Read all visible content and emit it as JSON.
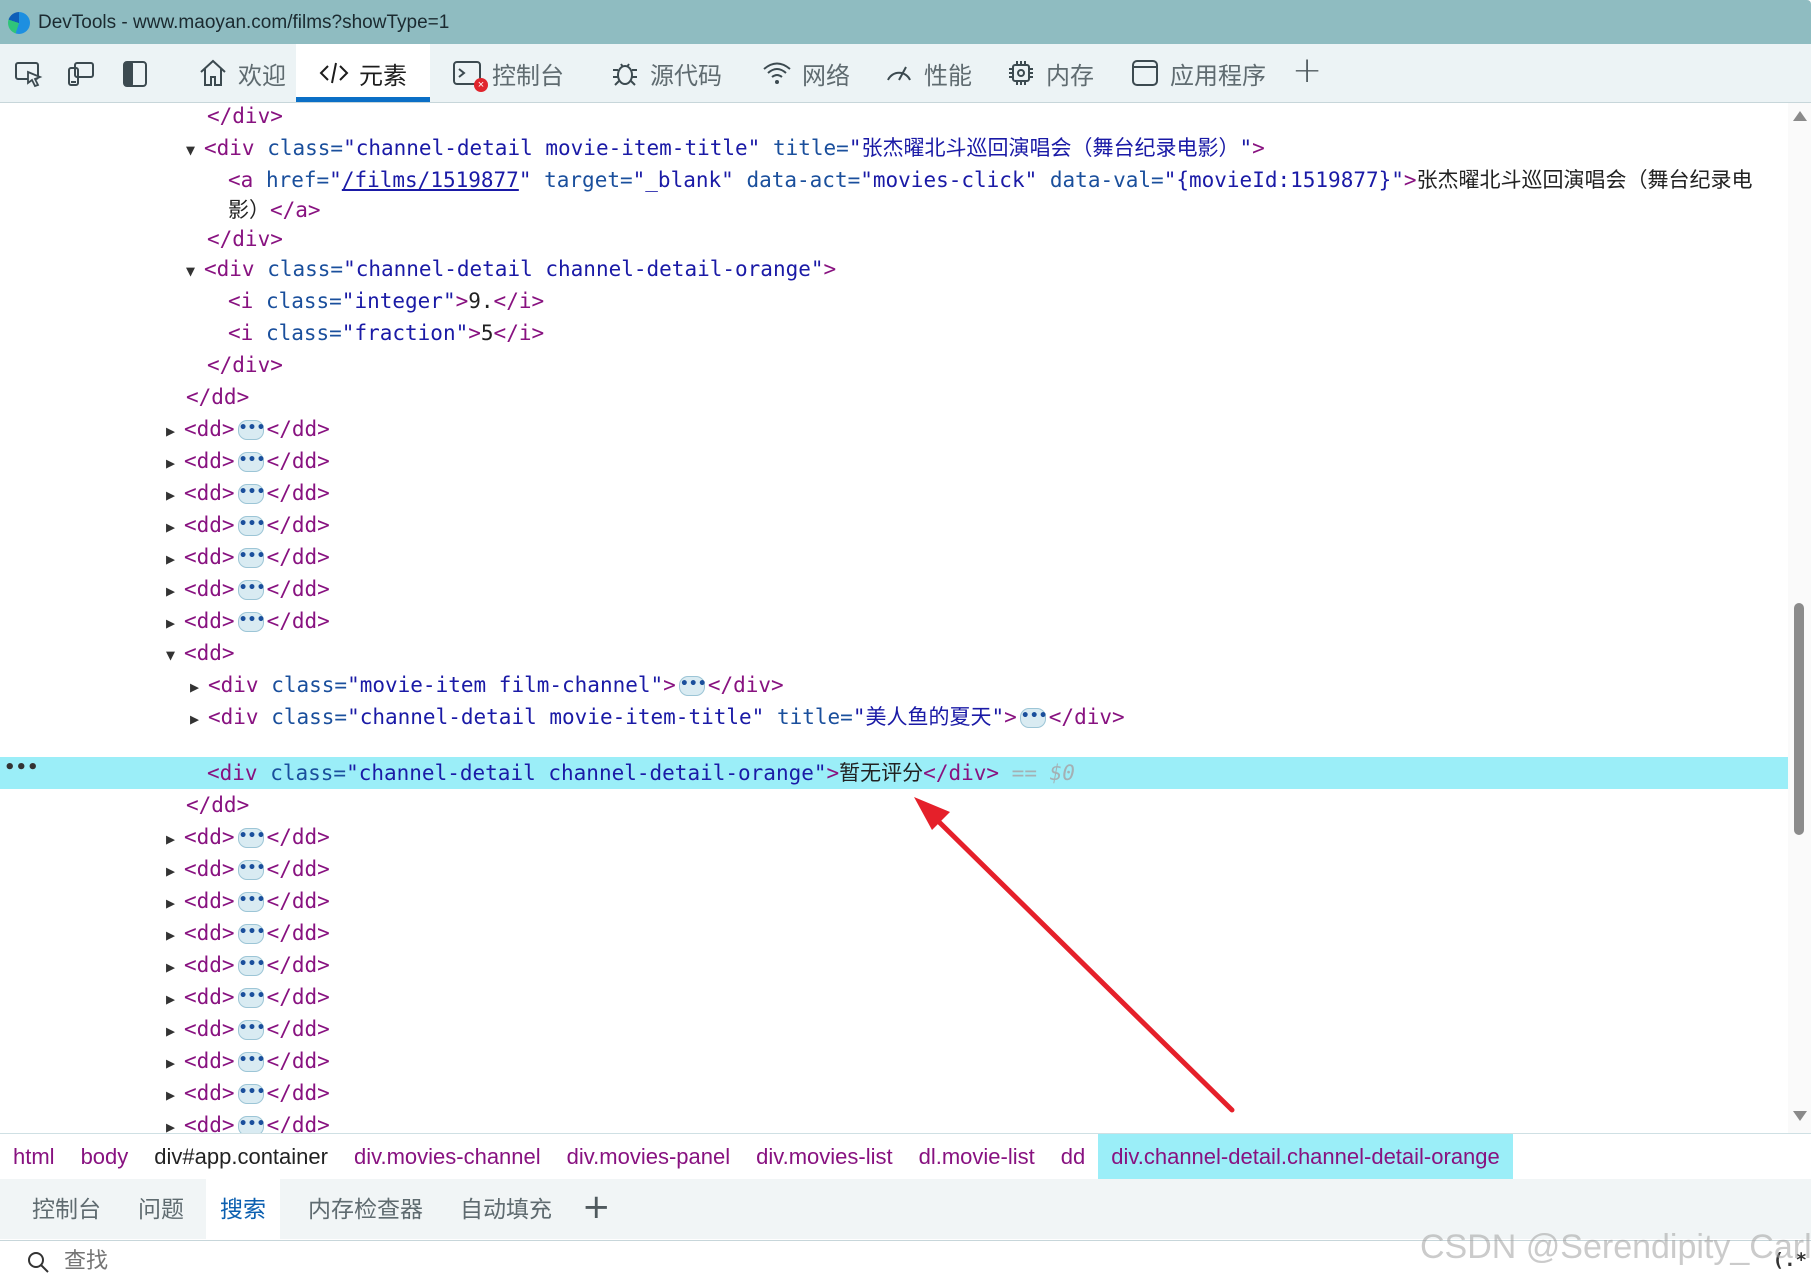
{
  "window": {
    "title": "DevTools - www.maoyan.com/films?showType=1"
  },
  "toolbar": {
    "tabs": [
      {
        "label": "欢迎",
        "icon": "home-icon"
      },
      {
        "label": "元素",
        "icon": "code-icon",
        "active": true
      },
      {
        "label": "控制台",
        "icon": "console-icon",
        "badge": "error"
      },
      {
        "label": "源代码",
        "icon": "bug-icon"
      },
      {
        "label": "网络",
        "icon": "wifi-icon"
      },
      {
        "label": "性能",
        "icon": "gauge-icon"
      },
      {
        "label": "内存",
        "icon": "chip-icon"
      },
      {
        "label": "应用程序",
        "icon": "app-window-icon"
      }
    ],
    "add": "+"
  },
  "code": {
    "l0": "</div>",
    "l1": {
      "tag_open": "<div ",
      "a1": "class=",
      "v1": "\"channel-detail movie-item-title\"",
      "a2": " title=",
      "v2": "\"张杰曜北斗巡回演唱会（舞台纪录电影）\"",
      "close": ">"
    },
    "l2": {
      "tag_open": "<a ",
      "a1": "href=",
      "v1q": "\"",
      "href": "/films/1519877",
      "v1q2": "\"",
      "a2": " target=",
      "v2": "\"_blank\"",
      "a3": " data-act=",
      "v3": "\"movies-click\"",
      "a4": " data-val=",
      "v4": "\"{movieId:1519877}\"",
      "close": ">",
      "text": "张杰曜北斗巡回演唱会（舞台纪录电"
    },
    "l3": {
      "text": "影）",
      "close": "</a>"
    },
    "l4": "</div>",
    "l5": {
      "tag_open": "<div ",
      "a1": "class=",
      "v1": "\"channel-detail channel-detail-orange\"",
      "close": ">"
    },
    "l6": {
      "tag_open": "<i ",
      "a1": "class=",
      "v1": "\"integer\"",
      "close": ">",
      "text": "9.",
      "end": "</i>"
    },
    "l7": {
      "tag_open": "<i ",
      "a1": "class=",
      "v1": "\"fraction\"",
      "close": ">",
      "text": "5",
      "end": "</i>"
    },
    "l8": "</div>",
    "l9": "</dd>",
    "dd_open": "<dd>",
    "dd_close": "</dd>",
    "ellipsis": "•••",
    "l17": "<dd>",
    "l18": {
      "tag_open": "<div ",
      "a1": "class=",
      "v1": "\"movie-item film-channel\"",
      "close": ">",
      "end": "</div>"
    },
    "l19": {
      "tag_open": "<div ",
      "a1": "class=",
      "v1": "\"channel-detail movie-item-title\"",
      "a2": " title=",
      "v2": "\"美人鱼的夏天\"",
      "close": ">",
      "end": "</div>"
    },
    "l20": {
      "tag_open": "<div ",
      "a1": "class=",
      "v1": "\"channel-detail channel-detail-orange\"",
      "close": ">",
      "text": "暂无评分",
      "end": "</div>",
      "ref": " == $0"
    },
    "l21": "</dd>"
  },
  "breadcrumb": [
    "html",
    "body",
    "div#app.container",
    "div.movies-channel",
    "div.movies-panel",
    "div.movies-list",
    "dl.movie-list",
    "dd",
    "div.channel-detail.channel-detail-orange"
  ],
  "drawer": {
    "tabs": [
      "控制台",
      "问题",
      "搜索",
      "内存检查器",
      "自动填充"
    ],
    "active": "搜索",
    "add": "+",
    "search_placeholder": "查找",
    "regex": "(.*"
  },
  "watermark": "CSDN @Serendipity_Carl",
  "colors": {
    "selection": "#9beef8",
    "tag": "#881280",
    "attr": "#1a4f9c",
    "value": "#1a1aa6",
    "accent": "#0b6fc6",
    "arrow": "#e5202a"
  }
}
